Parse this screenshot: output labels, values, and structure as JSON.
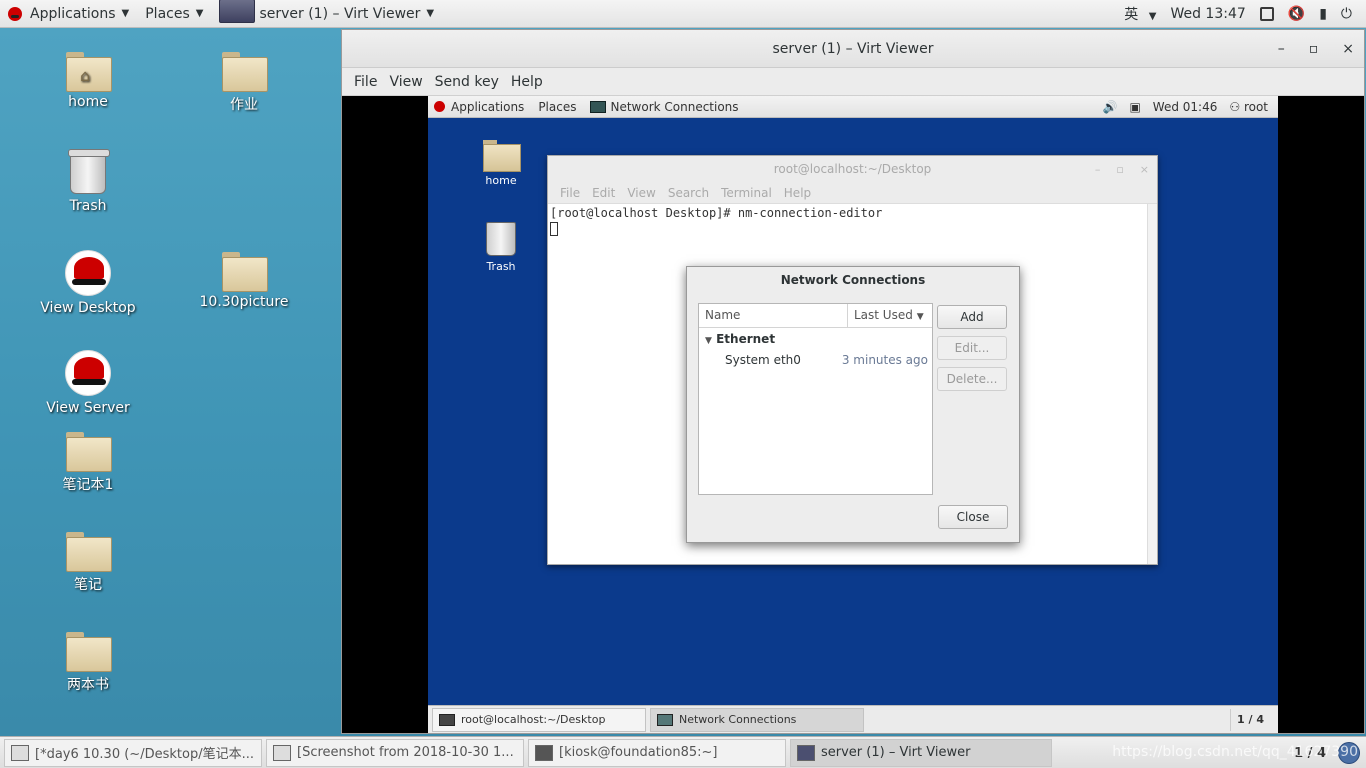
{
  "host": {
    "topbar": {
      "applications": "Applications",
      "places": "Places",
      "active_window": "server (1) – Virt Viewer",
      "input_method": "英",
      "clock": "Wed 13:47"
    },
    "desktop_icons": [
      {
        "label": "home"
      },
      {
        "label": "作业"
      },
      {
        "label": "Trash"
      },
      {
        "label": "View Desktop"
      },
      {
        "label": "10.30picture"
      },
      {
        "label": "View Server"
      },
      {
        "label": "笔记本1"
      },
      {
        "label": "笔记"
      },
      {
        "label": "两本书"
      }
    ],
    "taskbar": {
      "items": [
        {
          "label": "[*day6 10.30 (~/Desktop/笔记本..."
        },
        {
          "label": "[Screenshot from 2018-10-30 1..."
        },
        {
          "label": "[kiosk@foundation85:~]"
        },
        {
          "label": "server (1) – Virt Viewer"
        }
      ],
      "pager": "1 / 4",
      "watermark": "https://blog.csdn.net/qq_41627390"
    }
  },
  "virt_viewer": {
    "title": "server (1) – Virt Viewer",
    "controls": {
      "minimize": "–",
      "maximize": "▫",
      "close": "×"
    },
    "menu": [
      "File",
      "View",
      "Send key",
      "Help"
    ]
  },
  "guest": {
    "topbar": {
      "applications": "Applications",
      "places": "Places",
      "active_window": "Network Connections",
      "clock": "Wed 01:46",
      "user": "root"
    },
    "desktop_icons": [
      {
        "label": "home"
      },
      {
        "label": "Trash"
      }
    ],
    "terminal": {
      "title": "root@localhost:~/Desktop",
      "menu": [
        "File",
        "Edit",
        "View",
        "Search",
        "Terminal",
        "Help"
      ],
      "prompt_line": "[root@localhost Desktop]# nm-connection-editor"
    },
    "network_dialog": {
      "title": "Network Connections",
      "col_name": "Name",
      "col_last_used": "Last Used",
      "group": "Ethernet",
      "rows": [
        {
          "name": "System eth0",
          "last_used": "3 minutes ago"
        }
      ],
      "buttons": {
        "add": "Add",
        "edit": "Edit...",
        "delete": "Delete...",
        "close": "Close"
      }
    },
    "taskbar": {
      "items": [
        {
          "label": "root@localhost:~/Desktop"
        },
        {
          "label": "Network Connections"
        }
      ],
      "pager": "1 / 4"
    }
  }
}
